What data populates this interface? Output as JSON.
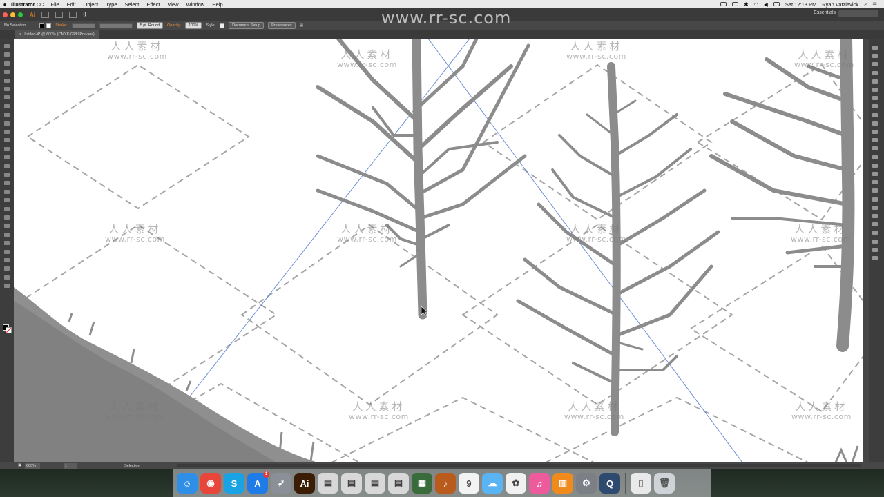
{
  "menubar": {
    "app_name": "Illustrator CC",
    "menus": [
      "File",
      "Edit",
      "Object",
      "Type",
      "Select",
      "Effect",
      "View",
      "Window",
      "Help"
    ],
    "clock": "Sat 12:13 PM",
    "user": "Ryan Vatzlavick"
  },
  "appbar": {
    "logo": "Ai",
    "workspace": "Essentials"
  },
  "control": {
    "selection": "No Selection",
    "stroke_label": "Stroke:",
    "brush": "5 pt. Round",
    "opacity_label": "Opacity:",
    "opacity_value": "100%",
    "style_label": "Style:",
    "document_setup": "Document Setup",
    "preferences": "Preferences"
  },
  "document": {
    "tab_title": "Untitled-4* @ 600% (CMYK/GPU Preview)"
  },
  "status": {
    "zoom": "600%",
    "artboard": "1",
    "tool": "Selection"
  },
  "watermark": {
    "top_url": "www.rr-sc.com",
    "cn": "人人素材",
    "url": "www.rr-sc.com"
  },
  "dock": {
    "apps": [
      {
        "name": "finder-icon",
        "glyph": "☺",
        "color": "#2f8ee6"
      },
      {
        "name": "chrome-icon",
        "glyph": "◉",
        "color": "#e9463b"
      },
      {
        "name": "skype-icon",
        "glyph": "S",
        "color": "#1aa3e4"
      },
      {
        "name": "app-store-icon",
        "glyph": "A",
        "color": "#1e7ce8"
      },
      {
        "name": "launchpad-icon",
        "glyph": "➶",
        "color": "#8a8f98"
      },
      {
        "name": "illustrator-icon",
        "glyph": "Ai",
        "color": "#3a1d04"
      },
      {
        "name": "document-icon",
        "glyph": "▤",
        "color": "#d8d8d8"
      },
      {
        "name": "document-icon",
        "glyph": "▤",
        "color": "#d8d8d8"
      },
      {
        "name": "document-icon",
        "glyph": "▤",
        "color": "#d8d8d8"
      },
      {
        "name": "document-icon",
        "glyph": "▤",
        "color": "#d8d8d8"
      },
      {
        "name": "photo-booth-icon",
        "glyph": "▦",
        "color": "#3a6b3a"
      },
      {
        "name": "garageband-icon",
        "glyph": "♪",
        "color": "#b85b1c"
      },
      {
        "name": "calendar-icon",
        "glyph": "9",
        "color": "#f3f3f3"
      },
      {
        "name": "messages-icon",
        "glyph": "☁",
        "color": "#5ab3f2"
      },
      {
        "name": "photos-icon",
        "glyph": "✿",
        "color": "#f1f1f1"
      },
      {
        "name": "itunes-icon",
        "glyph": "♫",
        "color": "#ee5b9c"
      },
      {
        "name": "ibooks-icon",
        "glyph": "▥",
        "color": "#f08a1d"
      },
      {
        "name": "system-preferences-icon",
        "glyph": "⚙",
        "color": "#7c7f86"
      },
      {
        "name": "quicktime-icon",
        "glyph": "Q",
        "color": "#2e4a6e"
      }
    ],
    "app_store_badge": "1",
    "calendar_day": "9"
  }
}
